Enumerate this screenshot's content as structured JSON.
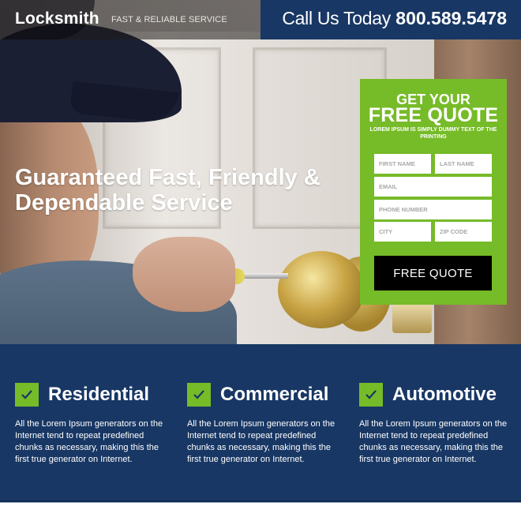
{
  "header": {
    "logo": "Locksmith",
    "tagline": "FAST & RELIABLE SERVICE",
    "call_label": "Call Us Today",
    "phone": "800.589.5478"
  },
  "hero": {
    "headline": "Guaranteed Fast, Friendly & Dependable Service"
  },
  "quote_form": {
    "title_line1": "GET YOUR",
    "title_line2": "FREE QUOTE",
    "subtitle": "LOREM IPSUM IS SIMPLY DUMMY TEXT OF THE PRINTING",
    "fields": {
      "first_name": {
        "placeholder": "FIRST NAME",
        "value": ""
      },
      "last_name": {
        "placeholder": "LAST NAME",
        "value": ""
      },
      "email": {
        "placeholder": "EMAIL",
        "value": ""
      },
      "phone": {
        "placeholder": "PHONE NUMBER",
        "value": ""
      },
      "city": {
        "placeholder": "CITY",
        "value": ""
      },
      "zip": {
        "placeholder": "ZIP CODE",
        "value": ""
      }
    },
    "submit_label": "FREE QUOTE"
  },
  "features": [
    {
      "icon": "check-icon",
      "title": "Residential",
      "text": "All the Lorem Ipsum generators on the Internet tend to repeat predefined chunks as necessary, making this the first true generator on Internet."
    },
    {
      "icon": "check-icon",
      "title": "Commercial",
      "text": "All the Lorem Ipsum generators on the Internet tend to repeat predefined chunks as necessary, making this the first true generator on Internet."
    },
    {
      "icon": "check-icon",
      "title": "Automotive",
      "text": "All the Lorem Ipsum generators on the Internet tend to repeat predefined chunks as necessary, making this the first true generator on Internet."
    }
  ],
  "colors": {
    "navy": "#183764",
    "green": "#76bb28",
    "button": "#000000",
    "white": "#ffffff"
  }
}
